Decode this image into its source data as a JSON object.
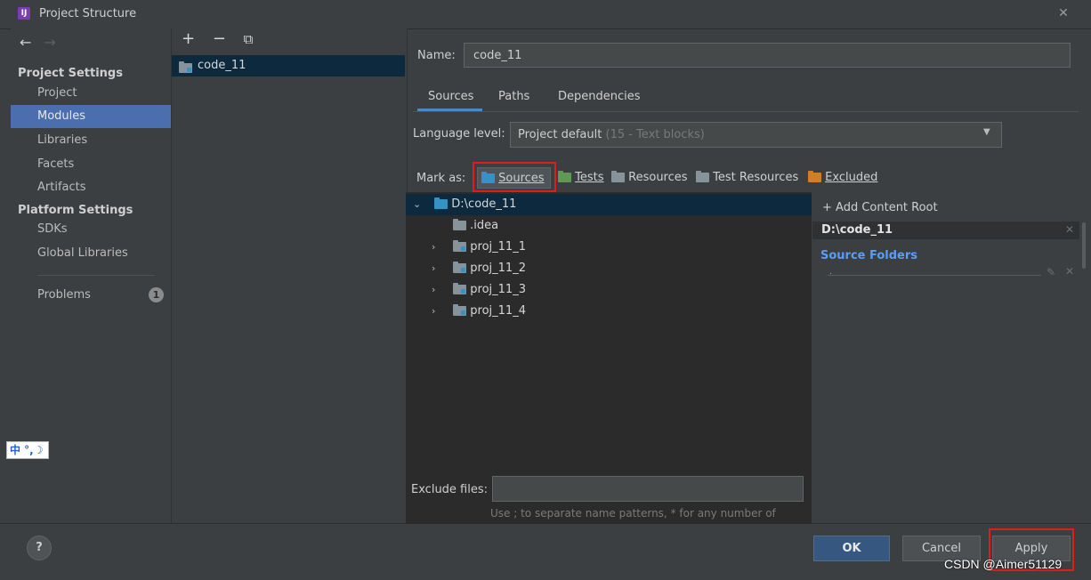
{
  "window": {
    "title": "Project Structure",
    "close_glyph": "✕",
    "logo_text": "IJ"
  },
  "nav": {
    "back": "←",
    "forward": "→",
    "project_settings_heading": "Project Settings",
    "platform_settings_heading": "Platform Settings",
    "items": {
      "project": "Project",
      "modules": "Modules",
      "libraries": "Libraries",
      "facets": "Facets",
      "artifacts": "Artifacts",
      "sdks": "SDKs",
      "global_libraries": "Global Libraries",
      "problems": "Problems"
    },
    "problems_count": "1"
  },
  "modules": {
    "add": "+",
    "remove": "−",
    "copy": "⧉",
    "items": [
      "code_11"
    ]
  },
  "module_detail": {
    "name_label": "Name:",
    "name_value": "code_11",
    "tabs": [
      "Sources",
      "Paths",
      "Dependencies"
    ],
    "active_tab": "Sources",
    "language_level_label": "Language level:",
    "language_level_value": "Project default",
    "language_level_hint": "(15 - Text blocks)",
    "mark_as_label": "Mark as:",
    "mark_as": {
      "sources": "Sources",
      "tests": "Tests",
      "resources": "Resources",
      "test_resources": "Test Resources",
      "excluded": "Excluded"
    },
    "tree": {
      "root": "D:\\code_11",
      "children": [
        ".idea",
        "proj_11_1",
        "proj_11_2",
        "proj_11_3",
        "proj_11_4"
      ]
    },
    "exclude_files_label": "Exclude files:",
    "exclude_files_hint": "Use ; to separate name patterns, * for any number of",
    "content_root": {
      "add_label": "+ Add Content Root",
      "root_path": "D:\\code_11",
      "source_folders_label": "Source Folders",
      "source_folder_entry": "."
    }
  },
  "buttons": {
    "ok": "OK",
    "cancel": "Cancel",
    "apply": "Apply",
    "help": "?"
  },
  "ime_indicator": "中 °,☽",
  "watermark": "CSDN @Aimer51129",
  "colors": {
    "accent": "#4b6eaf",
    "selection": "#0d293e",
    "highlight_box": "#e01c1c",
    "link": "#589df6"
  }
}
